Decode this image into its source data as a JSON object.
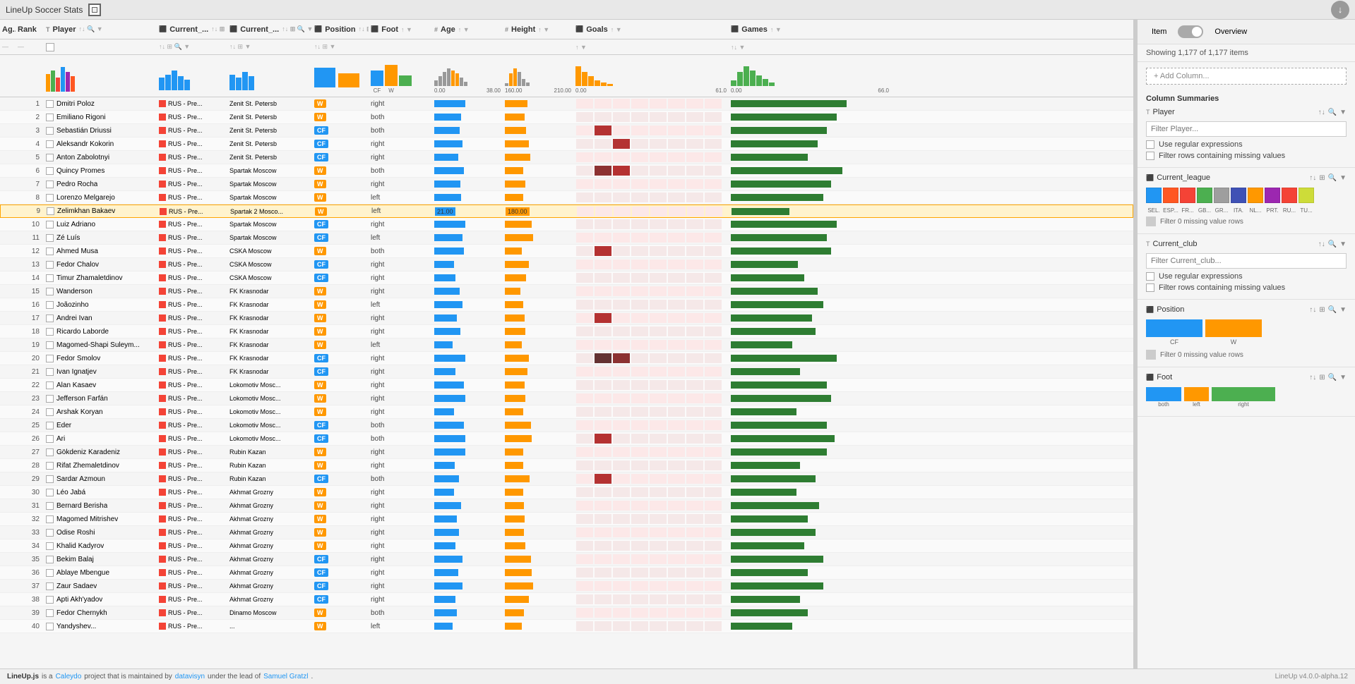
{
  "app": {
    "title": "LineUp Soccer Stats",
    "version": "LineUp v4.0.0-alpha.12"
  },
  "panel": {
    "item_label": "Item",
    "overview_label": "Overview",
    "count_text": "Showing 1,177 of 1,177 items",
    "add_column_placeholder": "+ Add Column...",
    "column_summaries_label": "Column Summaries"
  },
  "columns": {
    "ag": "Ag...",
    "rank": "Rank",
    "player": "Player",
    "current1": "Current_...",
    "current2": "Current_...",
    "position": "Position",
    "foot": "Foot",
    "age": "Age",
    "height": "Height",
    "goals": "Goals",
    "games": "Games"
  },
  "axis_labels": {
    "age_min": "0.00",
    "age_max": "38.00",
    "height_min": "160.00",
    "height_max": "210.00",
    "goals_min": "0.00",
    "goals_max": "61.0",
    "games_min": "0.00",
    "games_max": "66.0"
  },
  "foot_labels": {
    "cf": "CF",
    "w": "W",
    "both": "both",
    "left": "left",
    "right": "right"
  },
  "rows": [
    {
      "rank": 1,
      "name": "Dmitri Poloz",
      "league": "RUS - Pre...",
      "club": "Zenit St. Petersb",
      "pos": "W",
      "foot": "right",
      "age_bar": 55,
      "height_bar": 40,
      "goals_heat": [
        0,
        0,
        0,
        0,
        0,
        0,
        0,
        0
      ],
      "games_bar": 60
    },
    {
      "rank": 2,
      "name": "Emiliano Rigoni",
      "league": "RUS - Pre...",
      "club": "Zenit St. Petersb",
      "pos": "W",
      "foot": "both",
      "age_bar": 48,
      "height_bar": 35,
      "goals_heat": [
        0,
        0,
        0,
        0,
        0,
        0,
        0,
        0
      ],
      "games_bar": 55
    },
    {
      "rank": 3,
      "name": "Sebastián Driussi",
      "league": "RUS - Pre...",
      "club": "Zenit St. Petersb",
      "pos": "CF",
      "foot": "both",
      "age_bar": 45,
      "height_bar": 38,
      "goals_heat": [
        0,
        1,
        0,
        0,
        0,
        0,
        0,
        0
      ],
      "games_bar": 50
    },
    {
      "rank": 4,
      "name": "Aleksandr Kokorin",
      "league": "RUS - Pre...",
      "club": "Zenit St. Petersb",
      "pos": "CF",
      "foot": "right",
      "age_bar": 50,
      "height_bar": 42,
      "goals_heat": [
        0,
        0,
        1,
        0,
        0,
        0,
        0,
        0
      ],
      "games_bar": 45
    },
    {
      "rank": 5,
      "name": "Anton Zabolotnyi",
      "league": "RUS - Pre...",
      "club": "Zenit St. Petersb",
      "pos": "CF",
      "foot": "right",
      "age_bar": 42,
      "height_bar": 45,
      "goals_heat": [
        0,
        0,
        0,
        0,
        0,
        0,
        0,
        0
      ],
      "games_bar": 40
    },
    {
      "rank": 6,
      "name": "Quincy Promes",
      "league": "RUS - Pre...",
      "club": "Spartak Moscow",
      "pos": "W",
      "foot": "both",
      "age_bar": 52,
      "height_bar": 32,
      "goals_heat": [
        0,
        2,
        1,
        0,
        0,
        0,
        0,
        0
      ],
      "games_bar": 58
    },
    {
      "rank": 7,
      "name": "Pedro Rocha",
      "league": "RUS - Pre...",
      "club": "Spartak Moscow",
      "pos": "W",
      "foot": "right",
      "age_bar": 46,
      "height_bar": 36,
      "goals_heat": [
        0,
        0,
        0,
        0,
        0,
        0,
        0,
        0
      ],
      "games_bar": 52
    },
    {
      "rank": 8,
      "name": "Lorenzo Melgarejo",
      "league": "RUS - Pre...",
      "club": "Spartak Moscow",
      "pos": "W",
      "foot": "left",
      "age_bar": 48,
      "height_bar": 33,
      "goals_heat": [
        0,
        0,
        0,
        0,
        0,
        0,
        0,
        0
      ],
      "games_bar": 48
    },
    {
      "rank": 9,
      "name": "Zelimkhan Bakaev",
      "league": "RUS - Pre...",
      "club": "Spartak 2 Mosco...",
      "pos": "W",
      "foot": "left",
      "age_bar": 35,
      "height_bar": 30,
      "goals_heat": [
        0,
        0,
        0,
        0,
        0,
        0,
        0,
        0
      ],
      "games_bar": 30,
      "selected": true,
      "age_val": "21.00",
      "height_val": "180.00"
    },
    {
      "rank": 10,
      "name": "Luiz Adriano",
      "league": "RUS - Pre...",
      "club": "Spartak Moscow",
      "pos": "CF",
      "foot": "right",
      "age_bar": 55,
      "height_bar": 48,
      "goals_heat": [
        0,
        0,
        0,
        0,
        0,
        0,
        0,
        0
      ],
      "games_bar": 55
    },
    {
      "rank": 11,
      "name": "Zé Luís",
      "league": "RUS - Pre...",
      "club": "Spartak Moscow",
      "pos": "CF",
      "foot": "left",
      "age_bar": 50,
      "height_bar": 50,
      "goals_heat": [
        0,
        0,
        0,
        0,
        0,
        0,
        0,
        0
      ],
      "games_bar": 50
    },
    {
      "rank": 12,
      "name": "Ahmed Musa",
      "league": "RUS - Pre...",
      "club": "CSKA Moscow",
      "pos": "W",
      "foot": "both",
      "age_bar": 52,
      "height_bar": 30,
      "goals_heat": [
        0,
        1,
        0,
        0,
        0,
        0,
        0,
        0
      ],
      "games_bar": 52
    },
    {
      "rank": 13,
      "name": "Fedor Chalov",
      "league": "RUS - Pre...",
      "club": "CSKA Moscow",
      "pos": "CF",
      "foot": "right",
      "age_bar": 35,
      "height_bar": 42,
      "goals_heat": [
        0,
        0,
        0,
        0,
        0,
        0,
        0,
        0
      ],
      "games_bar": 35
    },
    {
      "rank": 14,
      "name": "Timur Zhаmaletdinov",
      "league": "RUS - Pre...",
      "club": "CSKA Moscow",
      "pos": "CF",
      "foot": "right",
      "age_bar": 38,
      "height_bar": 38,
      "goals_heat": [
        0,
        0,
        0,
        0,
        0,
        0,
        0,
        0
      ],
      "games_bar": 38
    },
    {
      "rank": 15,
      "name": "Wanderson",
      "league": "RUS - Pre...",
      "club": "FK Krasnodar",
      "pos": "W",
      "foot": "right",
      "age_bar": 45,
      "height_bar": 28,
      "goals_heat": [
        0,
        0,
        0,
        0,
        0,
        0,
        0,
        0
      ],
      "games_bar": 45
    },
    {
      "rank": 16,
      "name": "Joãozinho",
      "league": "RUS - Pre...",
      "club": "FK Krasnodar",
      "pos": "W",
      "foot": "left",
      "age_bar": 50,
      "height_bar": 32,
      "goals_heat": [
        0,
        0,
        0,
        0,
        0,
        0,
        0,
        0
      ],
      "games_bar": 48
    },
    {
      "rank": 17,
      "name": "Andrei Ivan",
      "league": "RUS - Pre...",
      "club": "FK Krasnodar",
      "pos": "W",
      "foot": "right",
      "age_bar": 40,
      "height_bar": 35,
      "goals_heat": [
        0,
        1,
        0,
        0,
        0,
        0,
        0,
        0
      ],
      "games_bar": 42
    },
    {
      "rank": 18,
      "name": "Ricardo Laborde",
      "league": "RUS - Pre...",
      "club": "FK Krasnodar",
      "pos": "W",
      "foot": "right",
      "age_bar": 46,
      "height_bar": 36,
      "goals_heat": [
        0,
        0,
        0,
        0,
        0,
        0,
        0,
        0
      ],
      "games_bar": 44
    },
    {
      "rank": 19,
      "name": "Magomed-Shapi Suleym...",
      "league": "RUS - Pre...",
      "club": "FK Krasnodar",
      "pos": "W",
      "foot": "left",
      "age_bar": 33,
      "height_bar": 30,
      "goals_heat": [
        0,
        0,
        0,
        0,
        0,
        0,
        0,
        0
      ],
      "games_bar": 32
    },
    {
      "rank": 20,
      "name": "Fedor Smolov",
      "league": "RUS - Pre...",
      "club": "FK Krasnodar",
      "pos": "CF",
      "foot": "right",
      "age_bar": 55,
      "height_bar": 42,
      "goals_heat": [
        0,
        3,
        2,
        0,
        0,
        0,
        0,
        0
      ],
      "games_bar": 55
    },
    {
      "rank": 21,
      "name": "Ivan Ignatjev",
      "league": "RUS - Pre...",
      "club": "FK Krasnodar",
      "pos": "CF",
      "foot": "right",
      "age_bar": 38,
      "height_bar": 40,
      "goals_heat": [
        0,
        0,
        0,
        0,
        0,
        0,
        0,
        0
      ],
      "games_bar": 36
    },
    {
      "rank": 22,
      "name": "Alan Kasaev",
      "league": "RUS - Pre...",
      "club": "Lokomotiv Mosc...",
      "pos": "W",
      "foot": "right",
      "age_bar": 52,
      "height_bar": 35,
      "goals_heat": [
        0,
        0,
        0,
        0,
        0,
        0,
        0,
        0
      ],
      "games_bar": 50
    },
    {
      "rank": 23,
      "name": "Jefferson Farfán",
      "league": "RUS - Pre...",
      "club": "Lokomotiv Mosc...",
      "pos": "W",
      "foot": "right",
      "age_bar": 55,
      "height_bar": 36,
      "goals_heat": [
        0,
        0,
        0,
        0,
        0,
        0,
        0,
        0
      ],
      "games_bar": 52
    },
    {
      "rank": 24,
      "name": "Arshak Koryan",
      "league": "RUS - Pre...",
      "club": "Lokomotiv Mosc...",
      "pos": "W",
      "foot": "right",
      "age_bar": 35,
      "height_bar": 32,
      "goals_heat": [
        0,
        0,
        0,
        0,
        0,
        0,
        0,
        0
      ],
      "games_bar": 34
    },
    {
      "rank": 25,
      "name": "Éder",
      "league": "RUS - Pre...",
      "club": "Lokomotiv Mosc...",
      "pos": "CF",
      "foot": "both",
      "age_bar": 52,
      "height_bar": 46,
      "goals_heat": [
        0,
        0,
        0,
        0,
        0,
        0,
        0,
        0
      ],
      "games_bar": 50
    },
    {
      "rank": 26,
      "name": "Ari",
      "league": "RUS - Pre...",
      "club": "Lokomotiv Mosc...",
      "pos": "CF",
      "foot": "both",
      "age_bar": 55,
      "height_bar": 48,
      "goals_heat": [
        0,
        1,
        0,
        0,
        0,
        0,
        0,
        0
      ],
      "games_bar": 54
    },
    {
      "rank": 27,
      "name": "Gökdeniz Karadeniz",
      "league": "RUS - Pre...",
      "club": "Rubin Kazan",
      "pos": "W",
      "foot": "right",
      "age_bar": 55,
      "height_bar": 32,
      "goals_heat": [
        0,
        0,
        0,
        0,
        0,
        0,
        0,
        0
      ],
      "games_bar": 50
    },
    {
      "rank": 28,
      "name": "Rifat Zhemaletdinov",
      "league": "RUS - Pre...",
      "club": "Rubin Kazan",
      "pos": "W",
      "foot": "right",
      "age_bar": 36,
      "height_bar": 33,
      "goals_heat": [
        0,
        0,
        0,
        0,
        0,
        0,
        0,
        0
      ],
      "games_bar": 36
    },
    {
      "rank": 29,
      "name": "Sardar Azmoun",
      "league": "RUS - Pre...",
      "club": "Rubin Kazan",
      "pos": "CF",
      "foot": "both",
      "age_bar": 44,
      "height_bar": 44,
      "goals_heat": [
        0,
        1,
        0,
        0,
        0,
        0,
        0,
        0
      ],
      "games_bar": 44
    },
    {
      "rank": 30,
      "name": "Léo Jabá",
      "league": "RUS - Pre...",
      "club": "Akhmat Grozny",
      "pos": "W",
      "foot": "right",
      "age_bar": 35,
      "height_bar": 33,
      "goals_heat": [
        0,
        0,
        0,
        0,
        0,
        0,
        0,
        0
      ],
      "games_bar": 34
    },
    {
      "rank": 31,
      "name": "Bernard Berisha",
      "league": "RUS - Pre...",
      "club": "Akhmat Grozny",
      "pos": "W",
      "foot": "right",
      "age_bar": 48,
      "height_bar": 34,
      "goals_heat": [
        0,
        0,
        0,
        0,
        0,
        0,
        0,
        0
      ],
      "games_bar": 46
    },
    {
      "rank": 32,
      "name": "Magomed Mitrishev",
      "league": "RUS - Pre...",
      "club": "Akhmat Grozny",
      "pos": "W",
      "foot": "right",
      "age_bar": 40,
      "height_bar": 35,
      "goals_heat": [
        0,
        0,
        0,
        0,
        0,
        0,
        0,
        0
      ],
      "games_bar": 40
    },
    {
      "rank": 33,
      "name": "Odise Roshi",
      "league": "RUS - Pre...",
      "club": "Akhmat Grozny",
      "pos": "W",
      "foot": "right",
      "age_bar": 44,
      "height_bar": 34,
      "goals_heat": [
        0,
        0,
        0,
        0,
        0,
        0,
        0,
        0
      ],
      "games_bar": 44
    },
    {
      "rank": 34,
      "name": "Khalid Kadyrov",
      "league": "RUS - Pre...",
      "club": "Akhmat Grozny",
      "pos": "W",
      "foot": "right",
      "age_bar": 38,
      "height_bar": 36,
      "goals_heat": [
        0,
        0,
        0,
        0,
        0,
        0,
        0,
        0
      ],
      "games_bar": 38
    },
    {
      "rank": 35,
      "name": "Bekim Balaj",
      "league": "RUS - Pre...",
      "club": "Akhmat Grozny",
      "pos": "CF",
      "foot": "right",
      "age_bar": 50,
      "height_bar": 46,
      "goals_heat": [
        0,
        0,
        0,
        0,
        0,
        0,
        0,
        0
      ],
      "games_bar": 48
    },
    {
      "rank": 36,
      "name": "Ablaye Mbengue",
      "league": "RUS - Pre...",
      "club": "Akhmat Grozny",
      "pos": "CF",
      "foot": "right",
      "age_bar": 42,
      "height_bar": 48,
      "goals_heat": [
        0,
        0,
        0,
        0,
        0,
        0,
        0,
        0
      ],
      "games_bar": 40
    },
    {
      "rank": 37,
      "name": "Zaur Sadaev",
      "league": "RUS - Pre...",
      "club": "Akhmat Grozny",
      "pos": "CF",
      "foot": "right",
      "age_bar": 50,
      "height_bar": 50,
      "goals_heat": [
        0,
        0,
        0,
        0,
        0,
        0,
        0,
        0
      ],
      "games_bar": 48
    },
    {
      "rank": 38,
      "name": "Apti Akh'yadov",
      "league": "RUS - Pre...",
      "club": "Akhmat Grozny",
      "pos": "CF",
      "foot": "right",
      "age_bar": 38,
      "height_bar": 42,
      "goals_heat": [
        0,
        0,
        0,
        0,
        0,
        0,
        0,
        0
      ],
      "games_bar": 36
    },
    {
      "rank": 39,
      "name": "Fedor Chernykh",
      "league": "RUS - Pre...",
      "club": "Dinamo Moscow",
      "pos": "W",
      "foot": "both",
      "age_bar": 40,
      "height_bar": 34,
      "goals_heat": [
        0,
        0,
        0,
        0,
        0,
        0,
        0,
        0
      ],
      "games_bar": 40
    },
    {
      "rank": 40,
      "name": "Yandyshev...",
      "league": "RUS - Pre...",
      "club": "...",
      "pos": "W",
      "foot": "left",
      "age_bar": 32,
      "height_bar": 30,
      "goals_heat": [
        0,
        0,
        0,
        0,
        0,
        0,
        0,
        0
      ],
      "games_bar": 32
    }
  ],
  "right_panel": {
    "sections": [
      {
        "id": "player",
        "label": "Player",
        "type": "text",
        "filter_placeholder": "Filter Player...",
        "use_regex_label": "Use regular expressions",
        "missing_label": "Filter rows containing missing values"
      },
      {
        "id": "current_league",
        "label": "Current_league",
        "type": "categorical",
        "leagues": [
          "SEL",
          "ESP...",
          "FR...",
          "GB...",
          "GR...",
          "ITA...",
          "NL...",
          "PRT...",
          "RU...",
          "TU..."
        ],
        "league_colors": [
          "#2196F3",
          "#FF5722",
          "#9C27B0",
          "#4CAF50",
          "#607D8B",
          "#3F51B5",
          "#FF9800",
          "#009688",
          "#F44336",
          "#CDDC39"
        ],
        "missing_label": "Filter 0 missing value rows"
      },
      {
        "id": "current_club",
        "label": "Current_club",
        "type": "text",
        "filter_placeholder": "Filter Current_club...",
        "use_regex_label": "Use regular expressions",
        "missing_label": "Filter rows containing missing values"
      },
      {
        "id": "position",
        "label": "Position",
        "type": "categorical",
        "missing_label": "Filter 0 missing value rows"
      },
      {
        "id": "foot",
        "label": "Foot",
        "type": "categorical"
      }
    ]
  },
  "footer": {
    "text1": "LineUp.js",
    "text2": " is a ",
    "caleydo": "Caleydo",
    "text3": " project that is maintained by ",
    "datavisyn": "datavisyn",
    "text4": " under the lead of ",
    "samuel": "Samuel Gratzl",
    "text5": ".",
    "version": "LineUp v4.0.0-alpha.12"
  }
}
